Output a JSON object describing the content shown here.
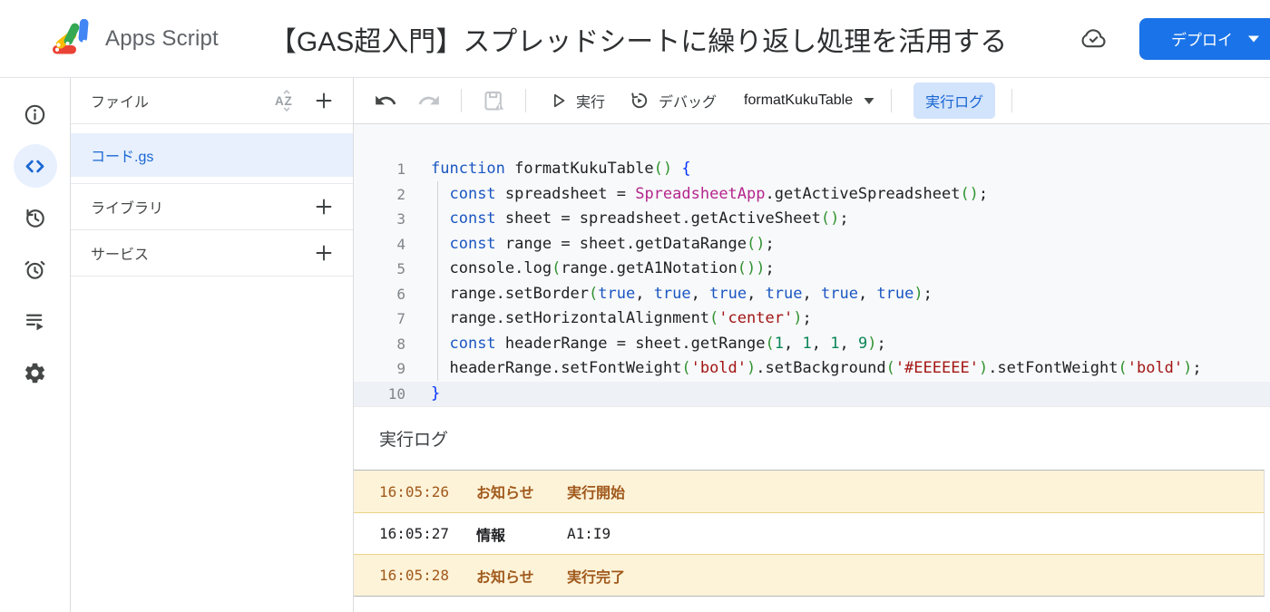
{
  "colors": {
    "accent_blue": "#1a73e8",
    "link_blue": "#1967d2",
    "selected_file_bg": "#e8f0fe",
    "run_log_chip_bg": "#d2e3fc",
    "editor_bg": "#f8f9fa",
    "notice_bg": "#fdf3d8",
    "notice_border": "#ecd489",
    "notice_text": "#a0591c",
    "token_keyword": "#1a56c2",
    "token_class": "#b3268c",
    "token_string": "#a31515",
    "token_number": "#098658",
    "token_paren": "#319331",
    "token_brace": "#0431fa"
  },
  "header": {
    "app_name": "Apps Script",
    "project_title": "【GAS超入門】スプレッドシートに繰り返し処理を活用する",
    "deploy_label": "デプロイ"
  },
  "rail": {
    "icons": [
      "info-icon",
      "code-editor-icon",
      "project-history-icon",
      "triggers-clock-icon",
      "executions-list-icon",
      "settings-gear-icon"
    ],
    "active": "code-editor-icon"
  },
  "sidebar": {
    "files_title": "ファイル",
    "files": [
      {
        "name": "コード.gs",
        "selected": true
      }
    ],
    "sections": [
      "ライブラリ",
      "サービス"
    ]
  },
  "toolbar": {
    "run": "実行",
    "debug": "デバッグ",
    "selected_function": "formatKukuTable",
    "execution_log": "実行ログ"
  },
  "editor": {
    "lines": [
      {
        "n": 1,
        "active": false,
        "seg": [
          [
            "k",
            "function"
          ],
          [
            "d",
            " formatKukuTable"
          ],
          [
            "p",
            "()"
          ],
          [
            "d",
            " "
          ],
          [
            "b",
            "{"
          ]
        ]
      },
      {
        "n": 2,
        "active": false,
        "seg": [
          [
            "d",
            "  "
          ],
          [
            "k",
            "const"
          ],
          [
            "d",
            " spreadsheet = "
          ],
          [
            "c",
            "SpreadsheetApp"
          ],
          [
            "d",
            ".getActiveSpreadsheet"
          ],
          [
            "p",
            "()"
          ],
          [
            "d",
            ";"
          ]
        ]
      },
      {
        "n": 3,
        "active": false,
        "seg": [
          [
            "d",
            "  "
          ],
          [
            "k",
            "const"
          ],
          [
            "d",
            " sheet = spreadsheet.getActiveSheet"
          ],
          [
            "p",
            "()"
          ],
          [
            "d",
            ";"
          ]
        ]
      },
      {
        "n": 4,
        "active": false,
        "seg": [
          [
            "d",
            "  "
          ],
          [
            "k",
            "const"
          ],
          [
            "d",
            " range = sheet.getDataRange"
          ],
          [
            "p",
            "()"
          ],
          [
            "d",
            ";"
          ]
        ]
      },
      {
        "n": 5,
        "active": false,
        "seg": [
          [
            "d",
            "  console.log"
          ],
          [
            "p",
            "("
          ],
          [
            "d",
            "range.getA1Notation"
          ],
          [
            "p",
            "())"
          ],
          [
            "d",
            ";"
          ]
        ]
      },
      {
        "n": 6,
        "active": false,
        "seg": [
          [
            "d",
            "  range.setBorder"
          ],
          [
            "p",
            "("
          ],
          [
            "k",
            "true"
          ],
          [
            "d",
            ", "
          ],
          [
            "k",
            "true"
          ],
          [
            "d",
            ", "
          ],
          [
            "k",
            "true"
          ],
          [
            "d",
            ", "
          ],
          [
            "k",
            "true"
          ],
          [
            "d",
            ", "
          ],
          [
            "k",
            "true"
          ],
          [
            "d",
            ", "
          ],
          [
            "k",
            "true"
          ],
          [
            "p",
            ")"
          ],
          [
            "d",
            ";"
          ]
        ]
      },
      {
        "n": 7,
        "active": false,
        "seg": [
          [
            "d",
            "  range.setHorizontalAlignment"
          ],
          [
            "p",
            "("
          ],
          [
            "s",
            "'center'"
          ],
          [
            "p",
            ")"
          ],
          [
            "d",
            ";"
          ]
        ]
      },
      {
        "n": 8,
        "active": false,
        "seg": [
          [
            "d",
            "  "
          ],
          [
            "k",
            "const"
          ],
          [
            "d",
            " headerRange = sheet.getRange"
          ],
          [
            "p",
            "("
          ],
          [
            "n",
            "1"
          ],
          [
            "d",
            ", "
          ],
          [
            "n",
            "1"
          ],
          [
            "d",
            ", "
          ],
          [
            "n",
            "1"
          ],
          [
            "d",
            ", "
          ],
          [
            "n",
            "9"
          ],
          [
            "p",
            ")"
          ],
          [
            "d",
            ";"
          ]
        ]
      },
      {
        "n": 9,
        "active": false,
        "seg": [
          [
            "d",
            "  headerRange.setFontWeight"
          ],
          [
            "p",
            "("
          ],
          [
            "s",
            "'bold'"
          ],
          [
            "p",
            ")"
          ],
          [
            "d",
            ".setBackground"
          ],
          [
            "p",
            "("
          ],
          [
            "s",
            "'#EEEEEE'"
          ],
          [
            "p",
            ")"
          ],
          [
            "d",
            ".setFontWeight"
          ],
          [
            "p",
            "("
          ],
          [
            "s",
            "'bold'"
          ],
          [
            "p",
            ")"
          ],
          [
            "d",
            ";"
          ]
        ]
      },
      {
        "n": 10,
        "active": true,
        "seg": [
          [
            "b",
            "}"
          ]
        ]
      }
    ]
  },
  "log_panel": {
    "title": "実行ログ",
    "entries": [
      {
        "time": "16:05:26",
        "type": "お知らせ",
        "message": "実行開始",
        "level": "notice"
      },
      {
        "time": "16:05:27",
        "type": "情報",
        "message": "A1:I9",
        "level": "info"
      },
      {
        "time": "16:05:28",
        "type": "お知らせ",
        "message": "実行完了",
        "level": "notice"
      }
    ]
  }
}
